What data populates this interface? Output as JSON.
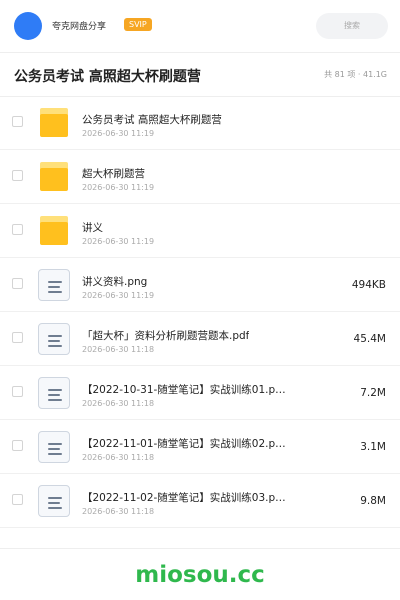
{
  "header": {
    "user_name": "夸克网盘分享",
    "badge": "SVIP",
    "search_placeholder": "搜索"
  },
  "folder": {
    "title": "公务员考试 高照超大杯刷题营",
    "meta": "共 81 项 · 41.1G"
  },
  "files": [
    {
      "type": "folder",
      "name": "公务员考试 高照超大杯刷题营",
      "date": "2026-06-30 11:19",
      "size": ""
    },
    {
      "type": "folder",
      "name": "超大杯刷题营",
      "date": "2026-06-30 11:19",
      "size": ""
    },
    {
      "type": "folder",
      "name": "讲义",
      "date": "2026-06-30 11:19",
      "size": ""
    },
    {
      "type": "file",
      "name": "讲义资料.png",
      "date": "2026-06-30 11:19",
      "size": "494KB"
    },
    {
      "type": "file",
      "name": "「超大杯」资料分析刷题营题本.pdf",
      "date": "2026-06-30 11:18",
      "size": "45.4M"
    },
    {
      "type": "file",
      "name": "【2022-10-31-随堂笔记】实战训练01.p…",
      "date": "2026-06-30 11:18",
      "size": "7.2M"
    },
    {
      "type": "file",
      "name": "【2022-11-01-随堂笔记】实战训练02.p…",
      "date": "2026-06-30 11:18",
      "size": "3.1M"
    },
    {
      "type": "file",
      "name": "【2022-11-02-随堂笔记】实战训练03.p…",
      "date": "2026-06-30 11:18",
      "size": "9.8M"
    }
  ],
  "watermark": "miosou.cc",
  "colors": {
    "avatar": "#2f7cf6",
    "badge": "#f6a623",
    "folder": "#ffc01e",
    "watermark": "#2fb84d"
  }
}
